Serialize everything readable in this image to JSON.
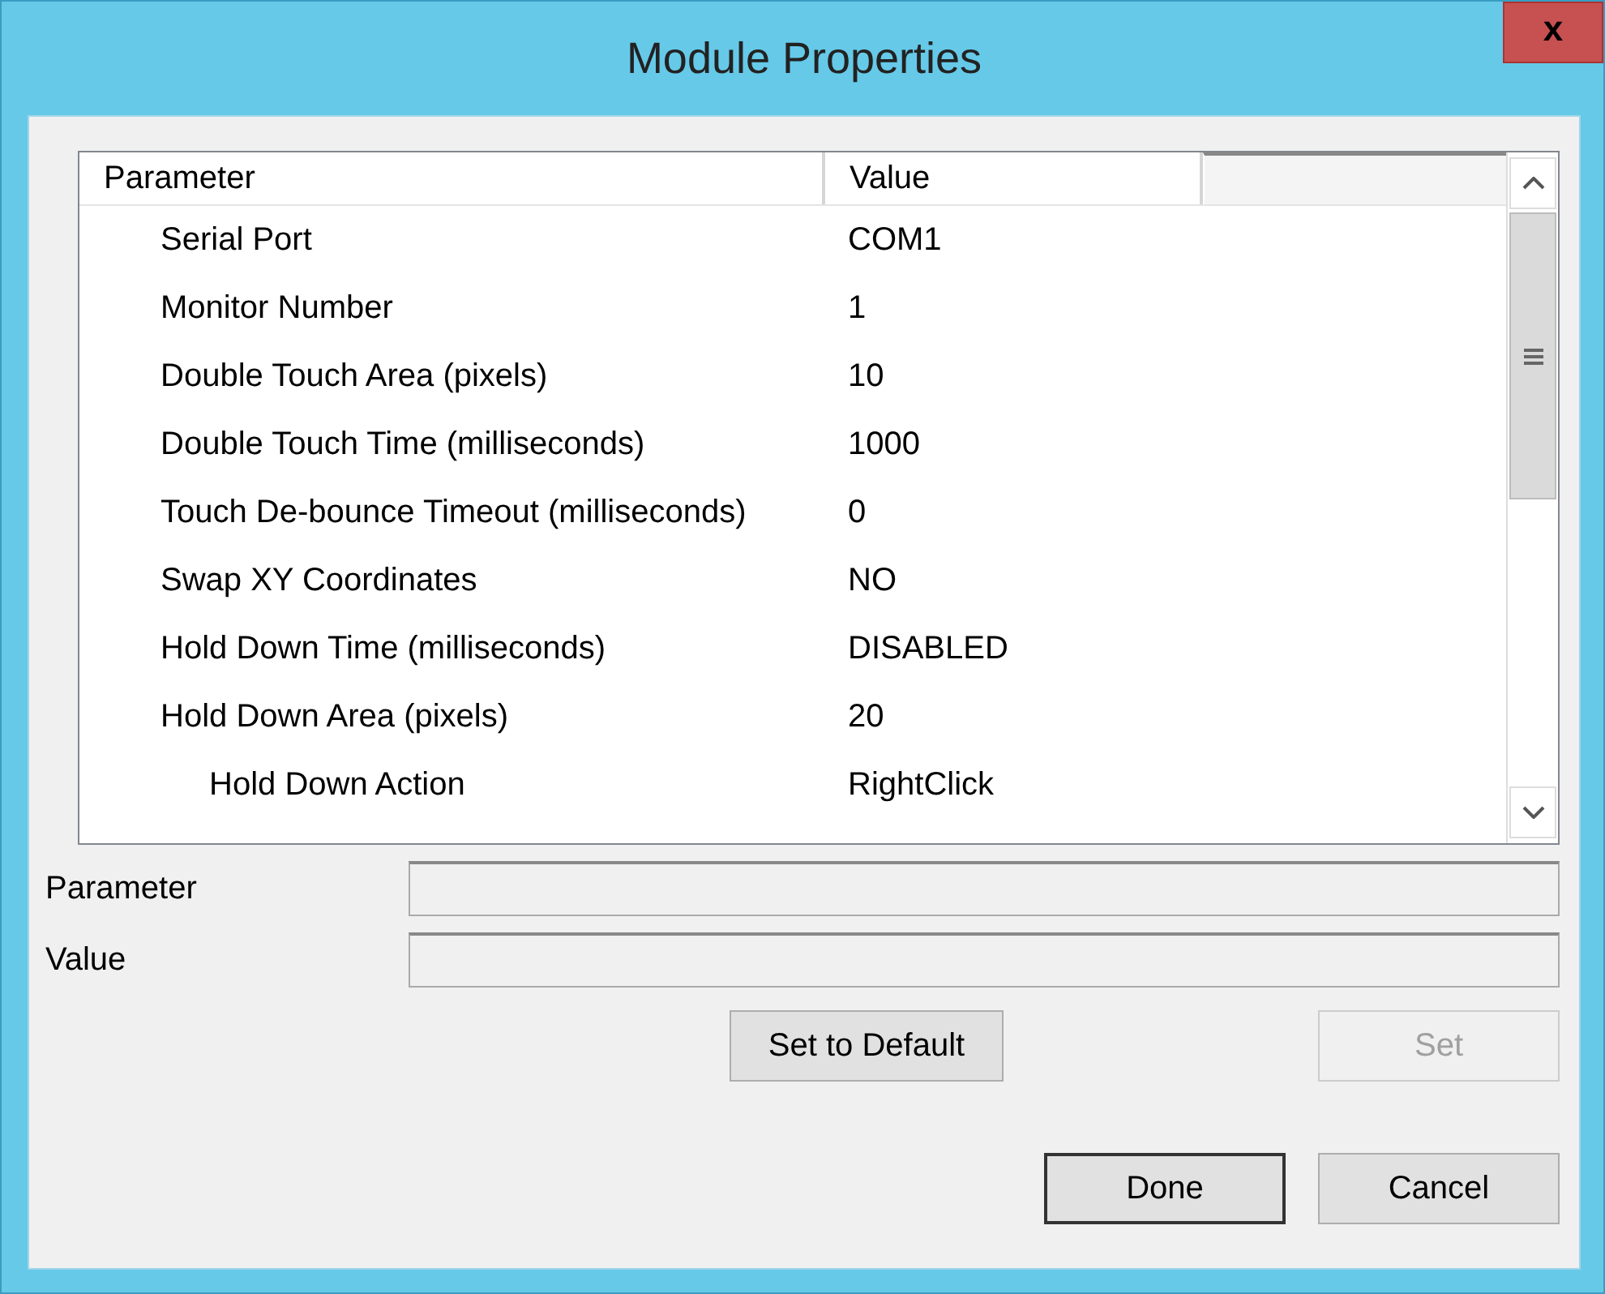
{
  "window": {
    "title": "Module Properties",
    "close": "x"
  },
  "list": {
    "columns": [
      "Parameter",
      "Value"
    ],
    "rows": [
      {
        "name": "Serial Port",
        "value": "COM1"
      },
      {
        "name": "Monitor Number",
        "value": "1"
      },
      {
        "name": "Double Touch Area (pixels)",
        "value": "10"
      },
      {
        "name": "Double Touch Time (milliseconds)",
        "value": "1000"
      },
      {
        "name": "Touch De-bounce Timeout (milliseconds)",
        "value": "0"
      },
      {
        "name": "Swap XY Coordinates",
        "value": "NO"
      },
      {
        "name": "Hold Down Time (milliseconds)",
        "value": "DISABLED"
      },
      {
        "name": "Hold Down Area (pixels)",
        "value": "20",
        "children": [
          {
            "name": "Hold Down Action",
            "value": "RightClick"
          }
        ]
      }
    ]
  },
  "fields": [
    {
      "label": "Parameter"
    },
    {
      "label": "Value"
    }
  ],
  "buttons": [
    {
      "label": "Set to Default",
      "disabled": false
    },
    {
      "label": "Set",
      "disabled": true
    }
  ],
  "footer_buttons": [
    {
      "label": "Done",
      "disabled": false
    },
    {
      "label": "Cancel",
      "disabled": false
    }
  ]
}
